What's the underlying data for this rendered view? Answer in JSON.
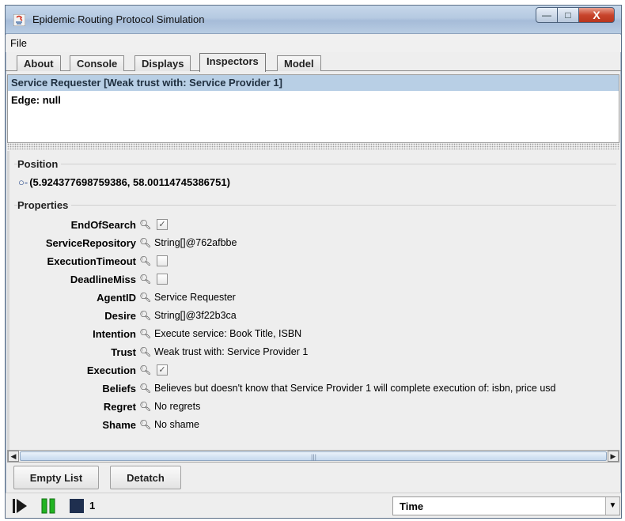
{
  "window": {
    "title": "Epidemic Routing Protocol Simulation",
    "controls": {
      "minimize": "—",
      "maximize": "□",
      "close": "X"
    }
  },
  "menu": {
    "file": "File"
  },
  "tabs": [
    {
      "label": "About"
    },
    {
      "label": "Console"
    },
    {
      "label": "Displays"
    },
    {
      "label": "Inspectors",
      "active": true
    },
    {
      "label": "Model"
    }
  ],
  "list": {
    "selected": "Service Requester [Weak trust with: Service Provider 1]",
    "edge": "Edge: null"
  },
  "position": {
    "title": "Position",
    "value": "(5.924377698759386, 58.00114745386751)"
  },
  "properties": {
    "title": "Properties",
    "end_of_search": {
      "label": "EndOfSearch",
      "checked": true
    },
    "service_repository": {
      "label": "ServiceRepository",
      "value": "String[]@762afbbe"
    },
    "execution_timeout": {
      "label": "ExecutionTimeout",
      "checked": false
    },
    "deadline_miss": {
      "label": "DeadlineMiss",
      "checked": false
    },
    "agent_id": {
      "label": "AgentID",
      "value": "Service Requester"
    },
    "desire": {
      "label": "Desire",
      "value": "String[]@3f22b3ca"
    },
    "intention": {
      "label": "Intention",
      "value": "Execute service: Book Title, ISBN"
    },
    "trust": {
      "label": "Trust",
      "value": "Weak trust with: Service Provider 1"
    },
    "execution": {
      "label": "Execution",
      "checked": true
    },
    "beliefs": {
      "label": "Beliefs",
      "value": "Believes but doesn't know that Service Provider 1 will complete execution of: isbn, price usd"
    },
    "regret": {
      "label": "Regret",
      "value": "No regrets"
    },
    "shame": {
      "label": "Shame",
      "value": "No shame"
    }
  },
  "buttons": {
    "empty_list": "Empty List",
    "detatch": "Detatch"
  },
  "controls": {
    "step": "1",
    "time_option": "Time"
  },
  "colors": {
    "selection": "#b8cfe5",
    "play": "#1a1a1a",
    "pause": "#22b422",
    "stop": "#1f2f4f"
  }
}
